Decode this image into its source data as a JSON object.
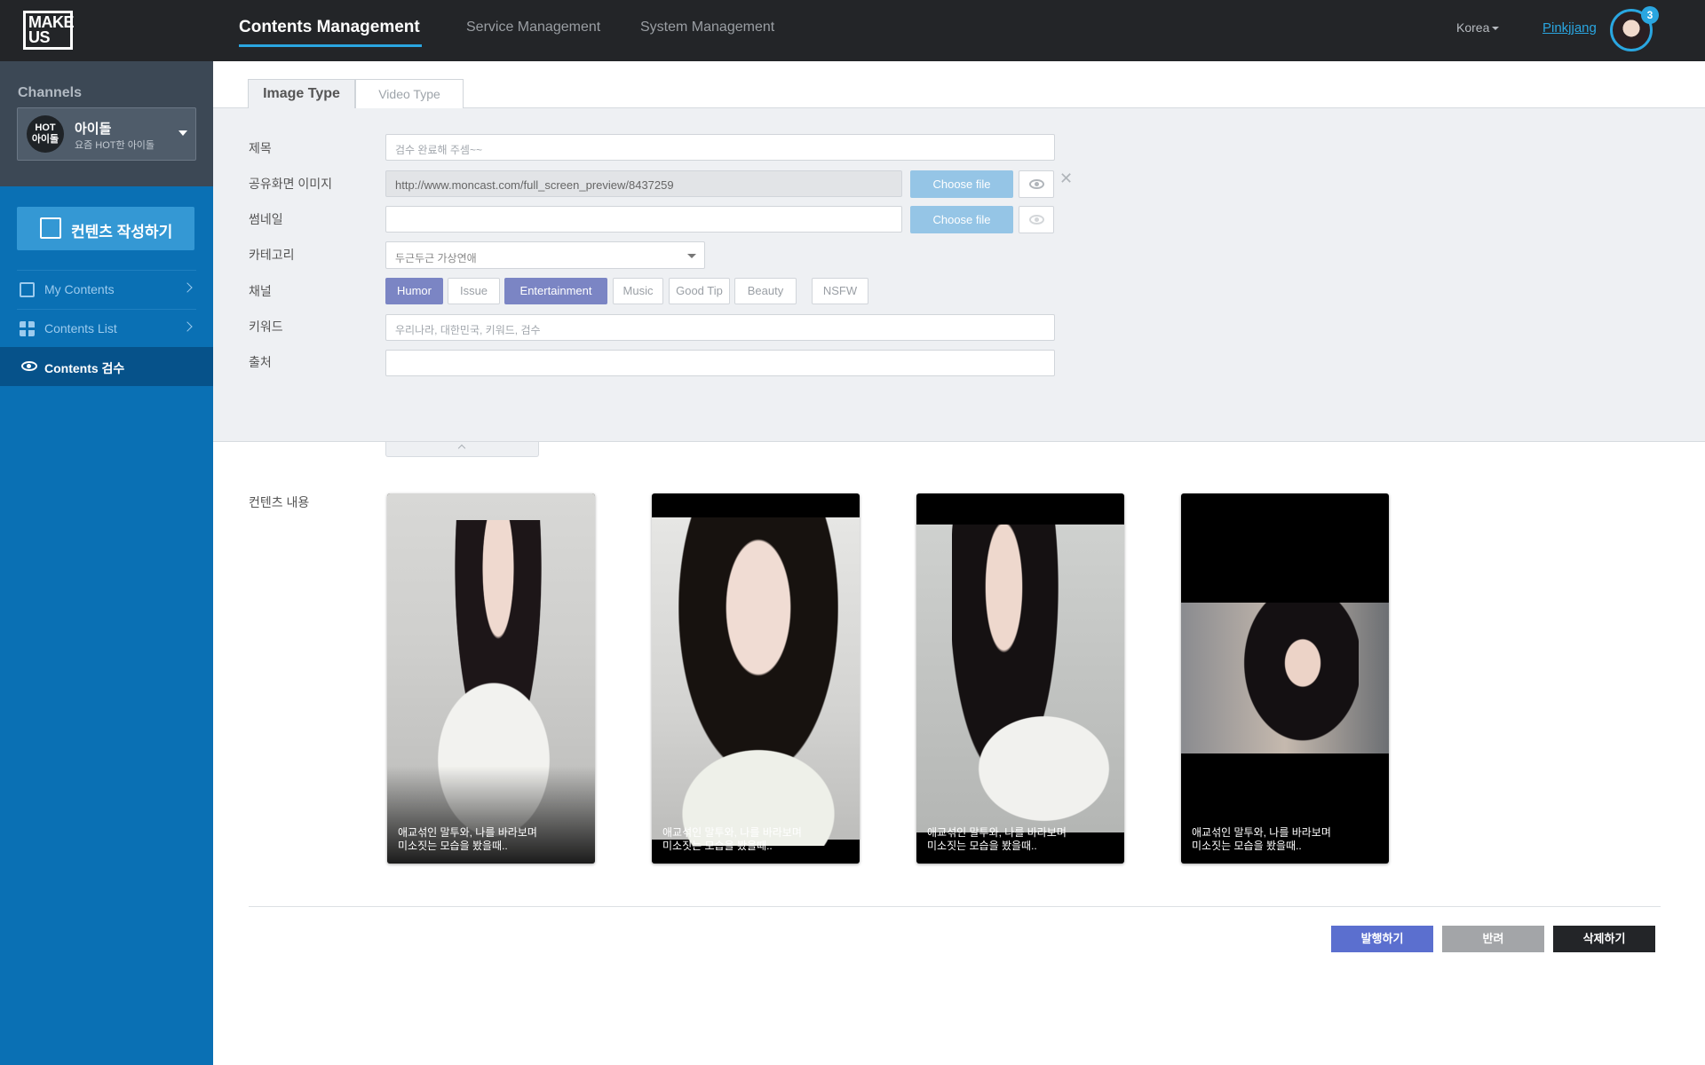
{
  "header": {
    "logo_line1": "MAKE",
    "logo_line2": "US",
    "nav": [
      {
        "label": "Contents Management"
      },
      {
        "label": "Service Management"
      },
      {
        "label": "System Management"
      }
    ],
    "language": "Korea",
    "username": "Pinkjjang",
    "notification_count": "3"
  },
  "sidebar": {
    "channels_title": "Channels",
    "channel": {
      "badge_line1": "HOT",
      "badge_line2": "아이돌",
      "name": "아이돌",
      "subtitle": "요즘 HOT한 아이돌"
    },
    "write_button": "컨텐츠 작성하기",
    "items": [
      {
        "label": "My Contents"
      },
      {
        "label": "Contents List"
      }
    ],
    "active_item": "Contents 검수"
  },
  "tabs": [
    {
      "label": "Image Type"
    },
    {
      "label": "Video Type"
    }
  ],
  "form": {
    "title_label": "제목",
    "title_placeholder": "검수 완료해 주셈~~",
    "share_image_label": "공유화면 이미지",
    "share_image_value": "http://www.moncast.com/full_screen_preview/8437259",
    "choose_file": "Choose file",
    "thumbnail_label": "썸네일",
    "category_label": "카테고리",
    "category_value": "두근두근 가상연애",
    "channel_label": "채널",
    "channel_chips": [
      {
        "label": "Humor",
        "selected": true
      },
      {
        "label": "Issue",
        "selected": false
      },
      {
        "label": "Entertainment",
        "selected": true
      },
      {
        "label": "Music",
        "selected": false
      },
      {
        "label": "Good Tip",
        "selected": false
      },
      {
        "label": "Beauty",
        "selected": false
      },
      {
        "label": "NSFW",
        "selected": false
      }
    ],
    "keyword_label": "키워드",
    "keyword_placeholder": "우리나라, 대한민국, 키워드, 검수",
    "source_label": "출처"
  },
  "content": {
    "label": "컨텐츠 내용",
    "cards": [
      {
        "caption": "애교섞인 말투와, 나를 바라보며\n미소짓는 모습을 봤을때.."
      },
      {
        "caption": "애교섞인 말투와, 나를 바라보며\n미소짓는 모습을 봤을때.."
      },
      {
        "caption": "애교섞인 말투와, 나를 바라보며\n미소짓는 모습을 봤을때.."
      },
      {
        "caption": "애교섞인 말투와, 나를 바라보며\n미소짓는 모습을 봤을때.."
      }
    ]
  },
  "actions": {
    "publish": "발행하기",
    "reject": "반려",
    "delete": "삭제하기"
  },
  "colors": {
    "topbar": "#232528",
    "sidebar": "#0a70b4",
    "accent": "#2aa6e0",
    "chip_selected": "#7b85c4",
    "publish": "#5b6fcf",
    "reject": "#a3a5a8",
    "delete": "#232528"
  }
}
